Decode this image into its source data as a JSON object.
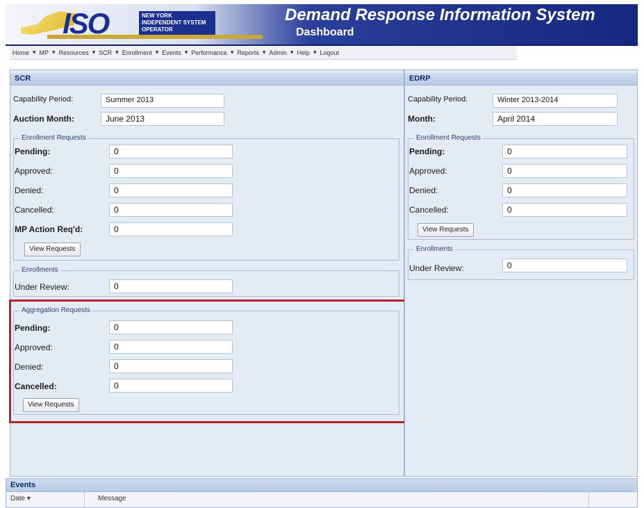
{
  "header": {
    "logo_text": "ISO",
    "logo_subtitle": "NEW YORK INDEPENDENT SYSTEM OPERATOR",
    "app_title": "Demand Response Information System",
    "page_subtitle": "Dashboard"
  },
  "menu": {
    "items": [
      "Home",
      "MP",
      "Resources",
      "SCR",
      "Enrollment",
      "Events",
      "Performance",
      "Reports",
      "Admin",
      "Help",
      "Logout"
    ]
  },
  "scr": {
    "title": "SCR",
    "capability_period_label": "Capability Period:",
    "capability_period_value": "Summer 2013",
    "auction_month_label": "Auction Month:",
    "auction_month_value": "June 2013",
    "enrollment_requests": {
      "legend": "Enrollment Requests",
      "pending_label": "Pending:",
      "pending_value": "0",
      "approved_label": "Approved:",
      "approved_value": "0",
      "denied_label": "Denied:",
      "denied_value": "0",
      "cancelled_label": "Cancelled:",
      "cancelled_value": "0",
      "mp_action_label": "MP Action Req'd:",
      "mp_action_value": "0",
      "view_button": "View Requests"
    },
    "enrollments": {
      "legend": "Enrollments",
      "under_review_label": "Under Review:",
      "under_review_value": "0"
    },
    "aggregation_requests": {
      "legend": "Aggregation Requests",
      "pending_label": "Pending:",
      "pending_value": "0",
      "approved_label": "Approved:",
      "approved_value": "0",
      "denied_label": "Denied:",
      "denied_value": "0",
      "cancelled_label": "Cancelled:",
      "cancelled_value": "0",
      "view_button": "View Requests"
    }
  },
  "edrp": {
    "title": "EDRP",
    "capability_period_label": "Capability Period:",
    "capability_period_value": "Winter 2013-2014",
    "month_label": "Month:",
    "month_value": "April 2014",
    "enrollment_requests": {
      "legend": "Enrollment Requests",
      "pending_label": "Pending:",
      "pending_value": "0",
      "approved_label": "Approved:",
      "approved_value": "0",
      "denied_label": "Denied:",
      "denied_value": "0",
      "cancelled_label": "Cancelled:",
      "cancelled_value": "0",
      "view_button": "View Requests"
    },
    "enrollments": {
      "legend": "Enrollments",
      "under_review_label": "Under Review:",
      "under_review_value": "0"
    }
  },
  "events": {
    "title": "Events",
    "col_date": "Date ▾",
    "col_message": "Message"
  },
  "colors": {
    "highlight": "#b3212b",
    "header_blue": "#16287e",
    "panel_bg": "#e3ebf5"
  }
}
